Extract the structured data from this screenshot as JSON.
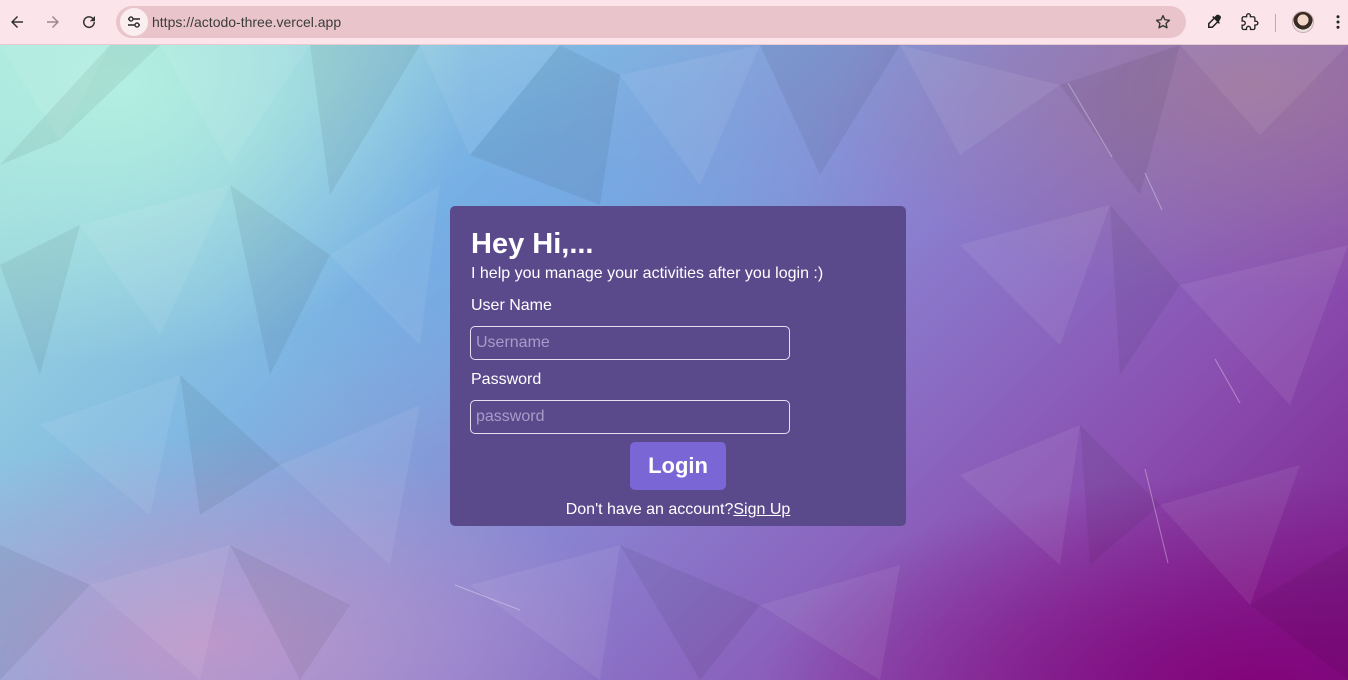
{
  "browser": {
    "url": "https://actodo-three.vercel.app"
  },
  "login": {
    "heading": "Hey Hi,...",
    "subtext": "I help you manage your activities after you login :)",
    "username_label": "User Name",
    "username_placeholder": "Username",
    "username_value": "",
    "password_label": "Password",
    "password_placeholder": "password",
    "password_value": "",
    "login_button": "Login",
    "signup_prompt": "Don't have an account?",
    "signup_link": "Sign Up"
  },
  "colors": {
    "card": "#5a4a8c",
    "button": "#7b66d6",
    "toolbar": "#fbe4ea"
  }
}
